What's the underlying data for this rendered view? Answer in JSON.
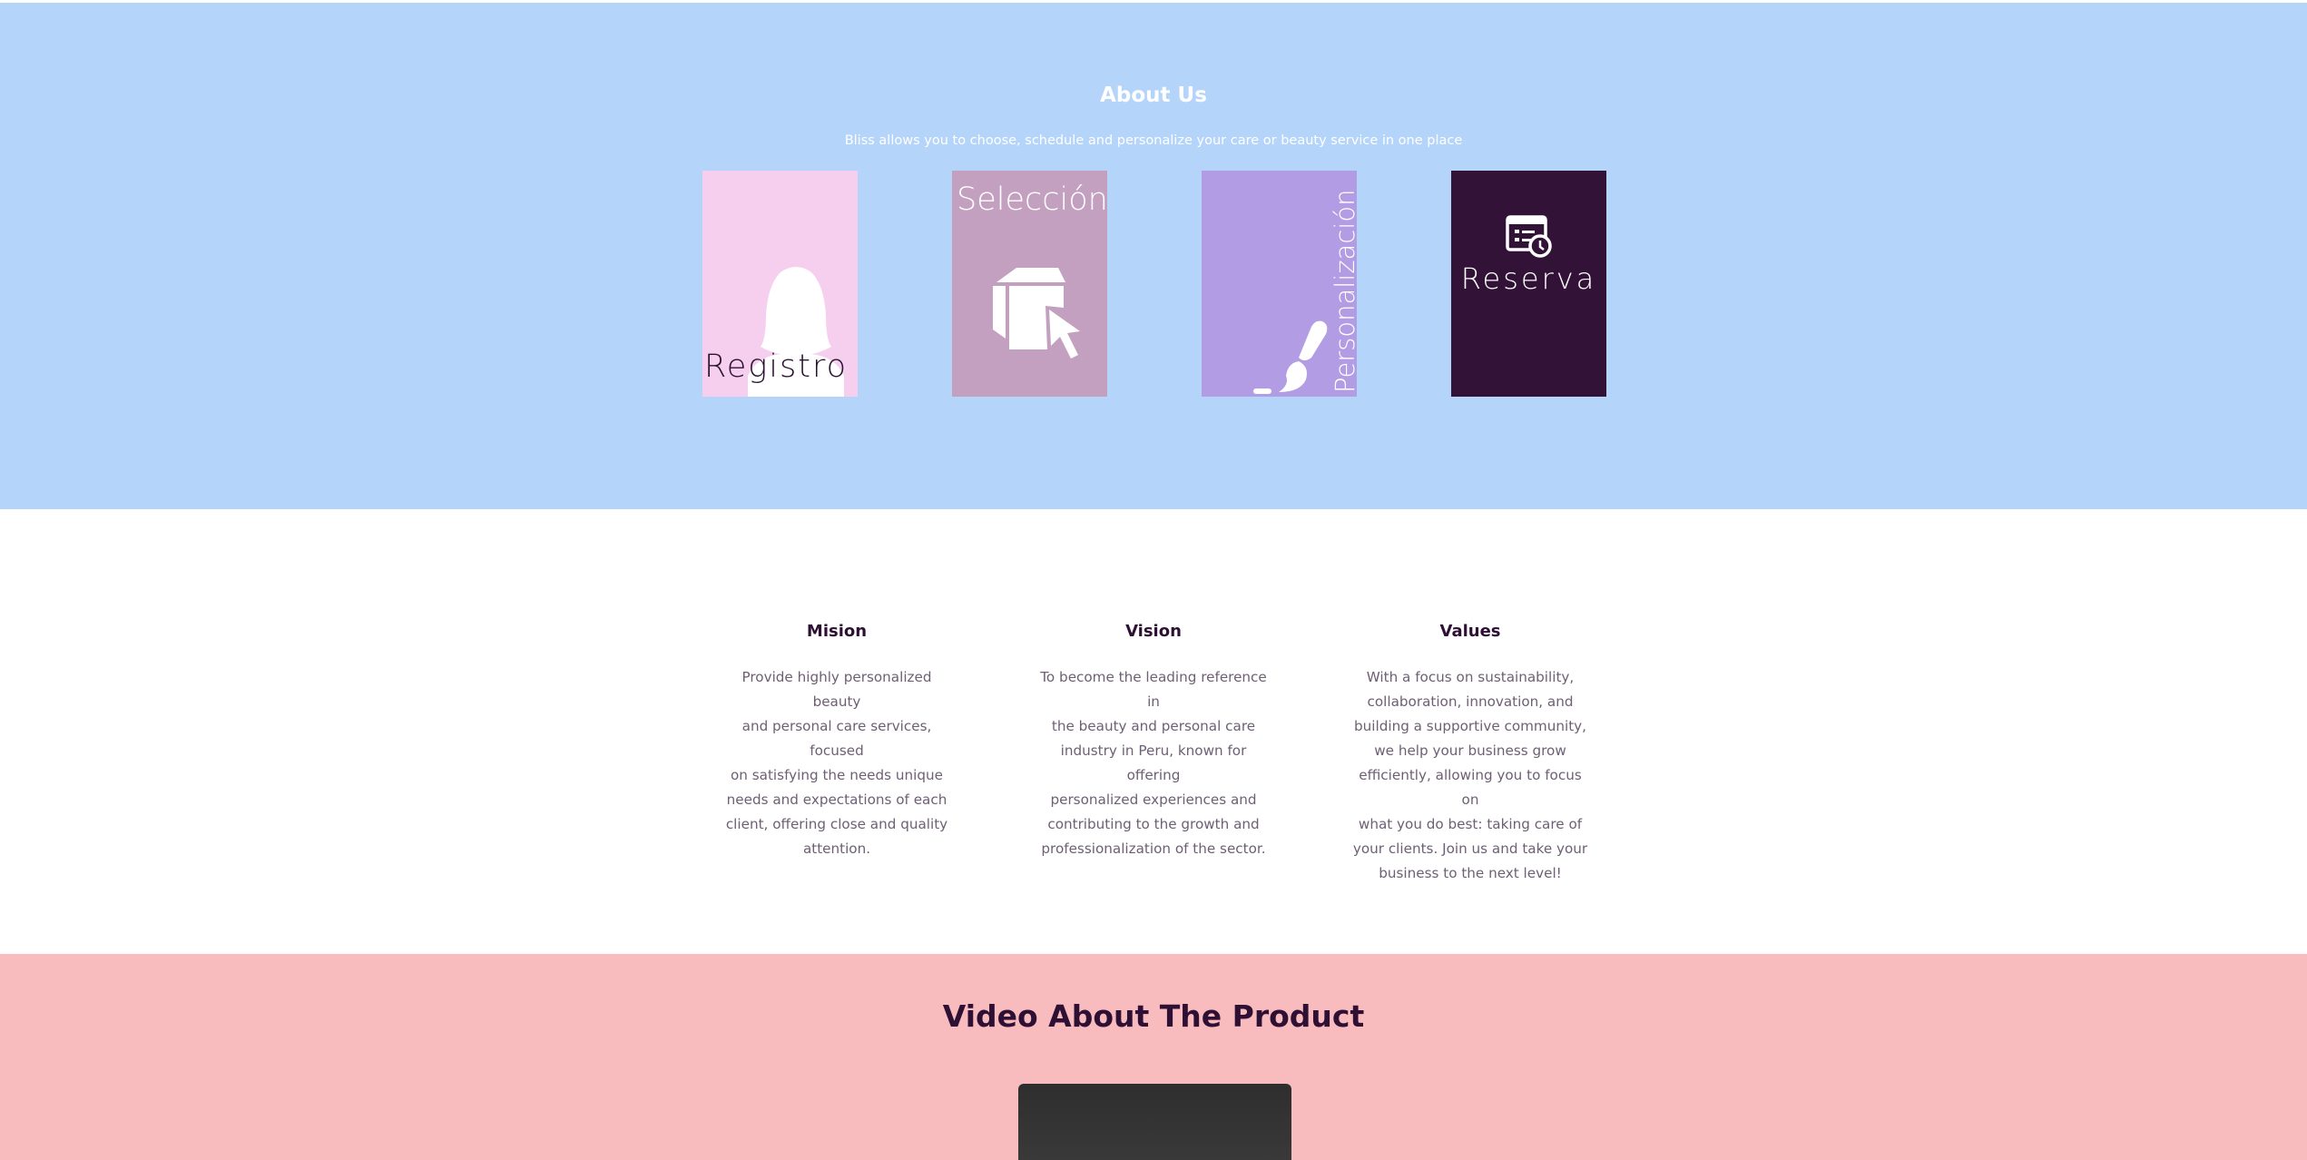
{
  "about": {
    "title": "About Us",
    "subtitle": "Bliss allows you to choose, schedule and personalize your care or beauty service in one place",
    "background": "#b4d4f9",
    "cards": [
      {
        "label": "Registro",
        "icon": "person-silhouette-icon",
        "color": "#f6cfee"
      },
      {
        "label": "Selección",
        "icon": "box-cursor-icon",
        "color": "#c4a0c0"
      },
      {
        "label": "Personalización",
        "icon": "paint-brush-icon",
        "color": "#b29ce3"
      },
      {
        "label": "Reserva",
        "icon": "calendar-clock-icon",
        "color": "#331238"
      }
    ]
  },
  "mvv": {
    "mision": {
      "heading": "Mision",
      "lines": [
        "Provide highly personalized beauty",
        "and personal care services, focused",
        "on satisfying the needs unique",
        "needs and expectations of each",
        "client, offering close and quality",
        "attention."
      ]
    },
    "vision": {
      "heading": "Vision",
      "lines": [
        "To become the leading reference in",
        "the beauty and personal care",
        "industry in Peru, known for offering",
        "personalized experiences and",
        "contributing to the growth and",
        "professionalization of the sector."
      ]
    },
    "values": {
      "heading": "Values",
      "lines": [
        "With a focus on sustainability,",
        "collaboration, innovation, and",
        "building a supportive community,",
        "we help your business grow",
        "efficiently, allowing you to focus on",
        "what you do best: taking care of",
        "your clients. Join us and take your",
        "business to the next level!"
      ]
    }
  },
  "video": {
    "title": "Video About The Product",
    "background": "#f9bcbe"
  }
}
